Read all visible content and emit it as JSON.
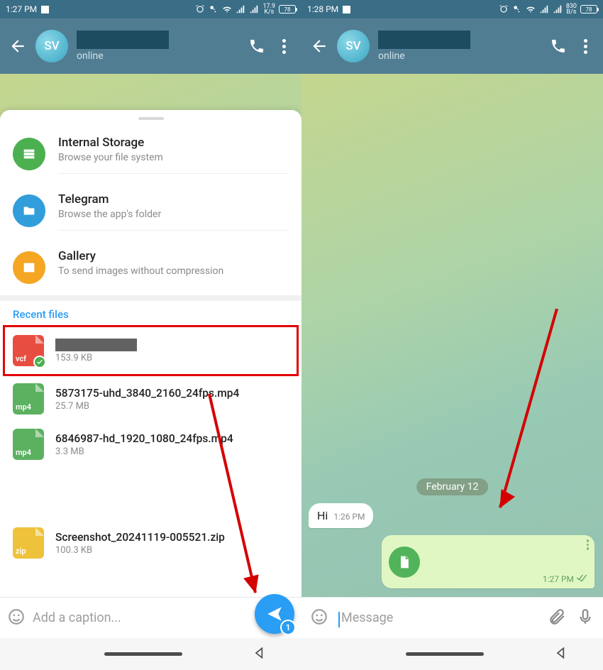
{
  "left": {
    "status": {
      "time": "1:27 PM",
      "speed_top": "17.9",
      "speed_bot": "K/s",
      "batt": "78"
    },
    "header": {
      "avatar": "SV",
      "status": "online"
    },
    "sources": [
      {
        "title": "Internal Storage",
        "sub": "Browse your file system"
      },
      {
        "title": "Telegram",
        "sub": "Browse the app's folder"
      },
      {
        "title": "Gallery",
        "sub": "To send images without compression"
      }
    ],
    "recent_label": "Recent files",
    "files": [
      {
        "ext": "vcf",
        "name": "",
        "size": "153.9 KB",
        "color": "red",
        "selected": true,
        "highlighted": true,
        "redacted": true
      },
      {
        "ext": "mp4",
        "name": "5873175-uhd_3840_2160_24fps.mp4",
        "size": "25.7 MB",
        "color": "green"
      },
      {
        "ext": "mp4",
        "name": "6846987-hd_1920_1080_24fps.mp4",
        "size": "3.3 MB",
        "color": "green"
      },
      {
        "ext": "zip",
        "name": "Screenshot_20241119-005521.zip",
        "size": "100.3 KB",
        "color": "yellow"
      }
    ],
    "caption_placeholder": "Add a caption...",
    "fab_badge": "1"
  },
  "right": {
    "status": {
      "time": "1:28 PM",
      "speed_top": "830",
      "speed_bot": "B/s",
      "batt": "78"
    },
    "header": {
      "avatar": "SV",
      "status": "online"
    },
    "date_chip": "February 12",
    "msg_in": {
      "text": "Hi",
      "time": "1:26 PM"
    },
    "msg_out": {
      "time": "1:27 PM"
    },
    "message_placeholder": "Message"
  }
}
